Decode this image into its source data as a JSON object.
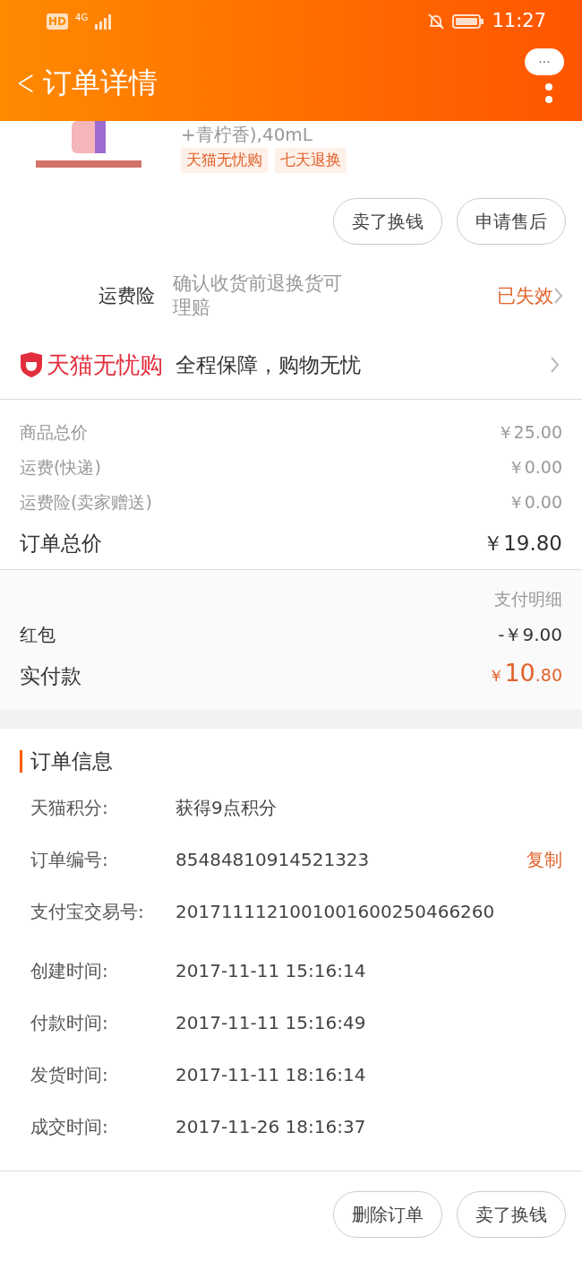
{
  "status_bar": {
    "hd_label": "HD",
    "network": "4G",
    "time": "11:27"
  },
  "header": {
    "back": "<",
    "title": "订单详情",
    "more_bubble": "···"
  },
  "product": {
    "title_fragment": "+青柠香),40mL",
    "tags": [
      "天猫无忧购",
      "七天退换"
    ]
  },
  "product_actions": [
    "卖了换钱",
    "申请售后"
  ],
  "insurance": {
    "label": "运费险",
    "description": "确认收货前退换货可理赔",
    "status": "已失效"
  },
  "guarantee": {
    "brand": "天猫无忧购",
    "slogan": "全程保障，购物无忧"
  },
  "price_rows": [
    {
      "kind": "minor",
      "label": "商品总价",
      "value": "￥25.00"
    },
    {
      "kind": "minor",
      "label": "运费(快递)",
      "value": "￥0.00"
    },
    {
      "kind": "minor",
      "label": "运费险(卖家赠送)",
      "value": "￥0.00"
    },
    {
      "kind": "total",
      "label": "订单总价",
      "value": "￥19.80"
    }
  ],
  "payment": {
    "detail_link": "支付明细",
    "discount": {
      "label": "红包",
      "value": "-￥9.00"
    },
    "paid": {
      "label": "实付款",
      "currency": "￥",
      "integer": "10",
      "fraction": ".80"
    }
  },
  "order_info": {
    "title": "订单信息",
    "rows": [
      {
        "label": "天猫积分:",
        "value": "获得9点积分"
      },
      {
        "label": "订单编号:",
        "value": "85484810914521323",
        "action": "复制"
      },
      {
        "label": "支付宝交易号:",
        "value": "2017111121001001600250466260"
      },
      {
        "label": "创建时间:",
        "value": "2017-11-11 15:16:14"
      },
      {
        "label": "付款时间:",
        "value": "2017-11-11 15:16:49"
      },
      {
        "label": "发货时间:",
        "value": "2017-11-11 18:16:14"
      },
      {
        "label": "成交时间:",
        "value": "2017-11-26 18:16:37"
      }
    ]
  },
  "footer_buttons": [
    "删除订单",
    "卖了换钱"
  ]
}
